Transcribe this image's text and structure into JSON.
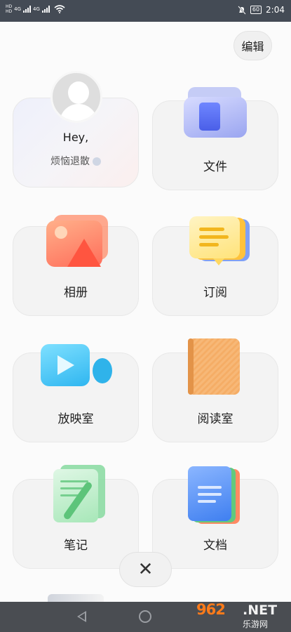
{
  "status_bar": {
    "hd_top": "HD",
    "hd_bottom": "HD",
    "net1": "4G",
    "net2": "4G",
    "battery": "60",
    "time": "2:04"
  },
  "toolbar": {
    "edit_label": "编辑"
  },
  "profile": {
    "greeting": "Hey,",
    "mood": "烦恼退散"
  },
  "apps": [
    {
      "label": "文件",
      "icon": "folder-icon"
    },
    {
      "label": "相册",
      "icon": "photo-album-icon"
    },
    {
      "label": "订阅",
      "icon": "subscription-bubble-icon"
    },
    {
      "label": "放映室",
      "icon": "video-camera-icon"
    },
    {
      "label": "阅读室",
      "icon": "book-icon"
    },
    {
      "label": "笔记",
      "icon": "notes-pen-icon"
    },
    {
      "label": "文档",
      "icon": "documents-icon"
    }
  ],
  "close_glyph": "✕",
  "watermark": {
    "number": "962",
    "net": ".NET",
    "site": "乐游网"
  },
  "colors": {
    "orange": "#ff7b1a",
    "card": "#f3f3f3",
    "statusbar": "#444b55"
  }
}
